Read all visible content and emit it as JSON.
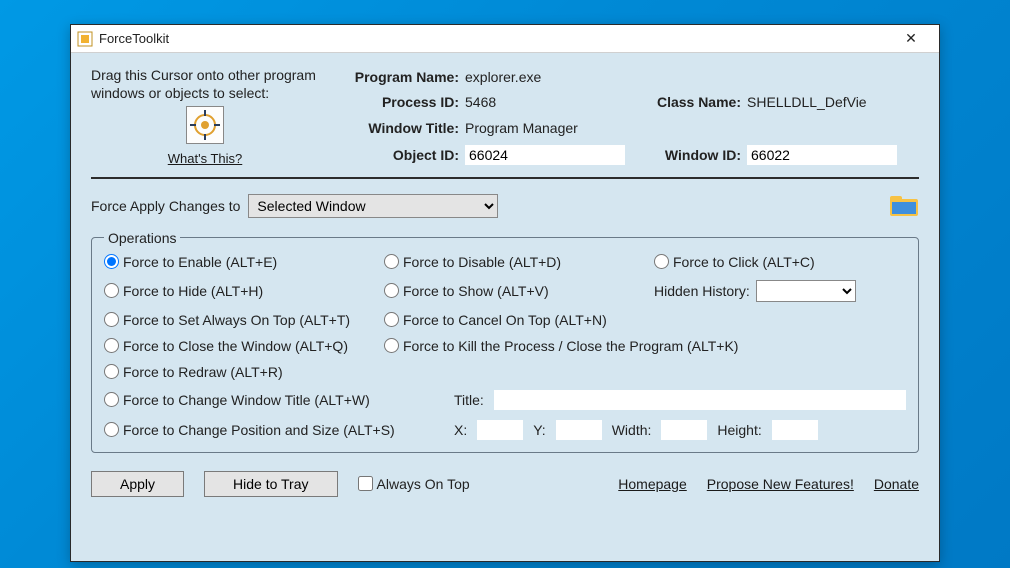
{
  "window": {
    "title": "ForceToolkit"
  },
  "dragHint": {
    "text": "Drag this Cursor onto other program windows or objects to select:",
    "whatsThis": "What's This?"
  },
  "info": {
    "programNameLabel": "Program Name:",
    "programName": "explorer.exe",
    "processIdLabel": "Process ID:",
    "processId": "5468",
    "classNameLabel": "Class Name:",
    "className": "SHELLDLL_DefVie",
    "windowTitleLabel": "Window Title:",
    "windowTitle": "Program Manager",
    "objectIdLabel": "Object ID:",
    "objectId": "66024",
    "windowIdLabel": "Window ID:",
    "windowId": "66022"
  },
  "applyTo": {
    "label": "Force Apply Changes to",
    "selected": "Selected Window"
  },
  "ops": {
    "legend": "Operations",
    "enable": "Force to Enable (ALT+E)",
    "disable": "Force to Disable (ALT+D)",
    "click": "Force to Click (ALT+C)",
    "hide": "Force to Hide (ALT+H)",
    "show": "Force to Show (ALT+V)",
    "hiddenHistoryLabel": "Hidden History:",
    "setTop": "Force to Set Always On Top (ALT+T)",
    "cancelTop": "Force to Cancel On Top (ALT+N)",
    "close": "Force to Close the Window (ALT+Q)",
    "kill": "Force to Kill the Process / Close the Program (ALT+K)",
    "redraw": "Force to Redraw (ALT+R)",
    "changeTitle": "Force to Change Window Title (ALT+W)",
    "titleLabel": "Title:",
    "titleValue": "",
    "changePos": "Force to Change Position and Size (ALT+S)",
    "xLabel": "X:",
    "x": "",
    "yLabel": "Y:",
    "y": "",
    "wLabel": "Width:",
    "w": "",
    "hLabel": "Height:",
    "h": ""
  },
  "bottom": {
    "apply": "Apply",
    "hideTray": "Hide to Tray",
    "alwaysOnTop": "Always On Top",
    "homepage": "Homepage",
    "propose": "Propose New Features!",
    "donate": "Donate"
  }
}
